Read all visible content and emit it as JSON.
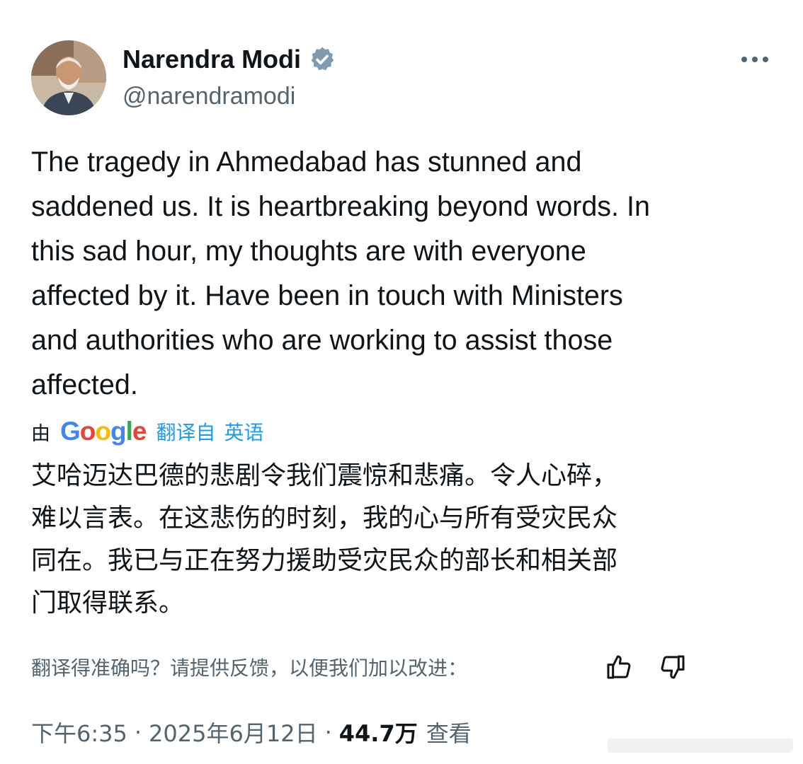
{
  "author": {
    "display_name": "Narendra Modi",
    "handle": "@narendramodi",
    "verified_icon": "verified-badge-icon"
  },
  "tweet": {
    "text_lines": [
      "The tragedy in Ahmedabad has stunned and",
      "saddened us. It is heartbreaking beyond words. In",
      "this sad hour, my thoughts are with everyone",
      "affected by it. Have been in touch with Ministers",
      "and authorities who are working to assist those",
      "affected."
    ]
  },
  "translation": {
    "by_label": "由",
    "provider": "Google",
    "link_label": "翻译自",
    "language": "英语",
    "text_lines": [
      "艾哈迈达巴德的悲剧令我们震惊和悲痛。令人心碎，",
      "难以言表。在这悲伤的时刻，我的心与所有受灾民众",
      "同在。我已与正在努力援助受灾民众的部长和相关部",
      "门取得联系。"
    ],
    "feedback_question": "翻译得准确吗？请提供反馈，以便我们加以改进："
  },
  "meta": {
    "time": "下午6:35",
    "separator": "·",
    "date": "2025年6月12日",
    "views_count": "44.7万",
    "views_label": "查看"
  },
  "colors": {
    "text_primary": "#0f1419",
    "text_secondary": "#536471",
    "link_blue": "#1d9bf0",
    "google_blue": "#4285F4",
    "google_red": "#EA4335",
    "google_yellow": "#FBBC05",
    "google_green": "#34A853"
  }
}
